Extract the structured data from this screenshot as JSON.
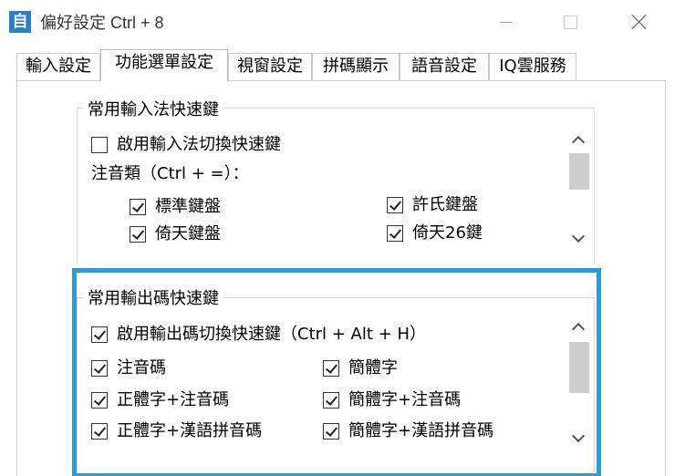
{
  "window": {
    "title": "偏好設定 Ctrl + 8",
    "app_icon_text": "自"
  },
  "tabs": [
    {
      "label": "輸入設定"
    },
    {
      "label": "功能選單設定"
    },
    {
      "label": "視窗設定"
    },
    {
      "label": "拼碼顯示"
    },
    {
      "label": "語音設定"
    },
    {
      "label": "IQ雲服務"
    }
  ],
  "active_tab": "功能選單設定",
  "group1": {
    "legend": "常用輸入法快速鍵",
    "enable": {
      "label": "啟用輸入法切換快速鍵",
      "checked": false
    },
    "zhuyin_heading": "注音類（Ctrl + =）：",
    "items": [
      {
        "label": "標準鍵盤",
        "checked": true
      },
      {
        "label": "許氏鍵盤",
        "checked": true
      },
      {
        "label": "倚天鍵盤",
        "checked": true
      },
      {
        "label": "倚天26鍵",
        "checked": true
      }
    ]
  },
  "group2": {
    "legend": "常用輸出碼快速鍵",
    "enable": {
      "label": "啟用輸出碼切換快速鍵（Ctrl + Alt + H）",
      "checked": true
    },
    "items": [
      {
        "label": "注音碼",
        "checked": true
      },
      {
        "label": "簡體字",
        "checked": true
      },
      {
        "label": "正體字+注音碼",
        "checked": true
      },
      {
        "label": "簡體字+注音碼",
        "checked": true
      },
      {
        "label": "正體字+漢語拼音碼",
        "checked": true
      },
      {
        "label": "簡體字+漢語拼音碼",
        "checked": true
      }
    ]
  },
  "colors": {
    "highlight": "#2f9bd6",
    "app_icon": "#2b7fc3"
  }
}
